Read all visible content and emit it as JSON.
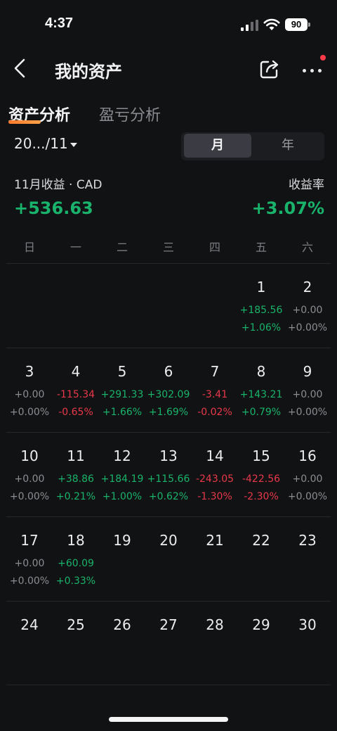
{
  "status_bar": {
    "time": "4:37",
    "battery": "90"
  },
  "nav": {
    "title": "我的资产"
  },
  "tabs": {
    "active": "资产分析",
    "inactive": "盈亏分析"
  },
  "date_selector": {
    "value": "20.../11"
  },
  "segment": {
    "month": "月",
    "year": "年"
  },
  "summary": {
    "label": "11月收益 · CAD",
    "value": "+536.63",
    "rate_label": "收益率",
    "rate_value": "+3.07%"
  },
  "weekdays": [
    "日",
    "一",
    "二",
    "三",
    "四",
    "五",
    "六"
  ],
  "colors": {
    "positive": "#19b36b",
    "negative": "#e8384a",
    "neutral": "#8c8d93",
    "accent": "#ff7a2a"
  },
  "weeks": [
    [
      null,
      null,
      null,
      null,
      null,
      {
        "day": "1",
        "amount": "+185.56",
        "pct": "+1.06%",
        "sign": "pos"
      },
      {
        "day": "2",
        "amount": "+0.00",
        "pct": "+0.00%",
        "sign": "zero"
      }
    ],
    [
      {
        "day": "3",
        "amount": "+0.00",
        "pct": "+0.00%",
        "sign": "zero"
      },
      {
        "day": "4",
        "amount": "-115.34",
        "pct": "-0.65%",
        "sign": "neg"
      },
      {
        "day": "5",
        "amount": "+291.33",
        "pct": "+1.66%",
        "sign": "pos"
      },
      {
        "day": "6",
        "amount": "+302.09",
        "pct": "+1.69%",
        "sign": "pos"
      },
      {
        "day": "7",
        "amount": "-3.41",
        "pct": "-0.02%",
        "sign": "neg"
      },
      {
        "day": "8",
        "amount": "+143.21",
        "pct": "+0.79%",
        "sign": "pos"
      },
      {
        "day": "9",
        "amount": "+0.00",
        "pct": "+0.00%",
        "sign": "zero"
      }
    ],
    [
      {
        "day": "10",
        "amount": "+0.00",
        "pct": "+0.00%",
        "sign": "zero"
      },
      {
        "day": "11",
        "amount": "+38.86",
        "pct": "+0.21%",
        "sign": "pos"
      },
      {
        "day": "12",
        "amount": "+184.19",
        "pct": "+1.00%",
        "sign": "pos"
      },
      {
        "day": "13",
        "amount": "+115.66",
        "pct": "+0.62%",
        "sign": "pos"
      },
      {
        "day": "14",
        "amount": "-243.05",
        "pct": "-1.30%",
        "sign": "neg"
      },
      {
        "day": "15",
        "amount": "-422.56",
        "pct": "-2.30%",
        "sign": "neg"
      },
      {
        "day": "16",
        "amount": "+0.00",
        "pct": "+0.00%",
        "sign": "zero"
      }
    ],
    [
      {
        "day": "17",
        "amount": "+0.00",
        "pct": "+0.00%",
        "sign": "zero"
      },
      {
        "day": "18",
        "amount": "+60.09",
        "pct": "+0.33%",
        "sign": "pos"
      },
      {
        "day": "19"
      },
      {
        "day": "20"
      },
      {
        "day": "21"
      },
      {
        "day": "22"
      },
      {
        "day": "23"
      }
    ],
    [
      {
        "day": "24"
      },
      {
        "day": "25"
      },
      {
        "day": "26"
      },
      {
        "day": "27"
      },
      {
        "day": "28"
      },
      {
        "day": "29"
      },
      {
        "day": "30"
      }
    ]
  ]
}
